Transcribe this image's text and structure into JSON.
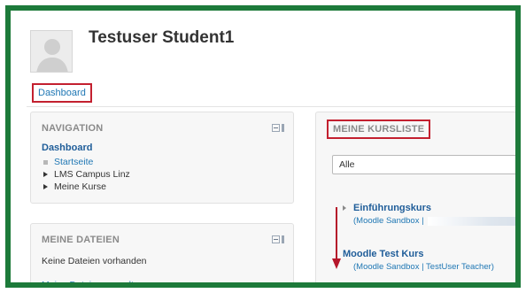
{
  "header": {
    "user_name": "Testuser Student1"
  },
  "breadcrumb": {
    "dashboard": "Dashboard"
  },
  "navigation": {
    "title": "NAVIGATION",
    "root": "Dashboard",
    "items": [
      {
        "label": "Startseite",
        "type": "link"
      },
      {
        "label": "LMS Campus Linz",
        "type": "expandable"
      },
      {
        "label": "Meine Kurse",
        "type": "expandable"
      }
    ]
  },
  "files": {
    "title": "MEINE DATEIEN",
    "empty_text": "Keine Dateien vorhanden",
    "manage_link": "Meine Dateien verwalten..."
  },
  "courses": {
    "title": "MEINE KURSLISTE",
    "filter_value": "Alle",
    "items": [
      {
        "name": "Einführungskurs",
        "meta": "(Moodle Sandbox  |"
      },
      {
        "name": "Moodle Test Kurs",
        "meta": "(Moodle Sandbox  |  TestUser Teacher)"
      }
    ]
  },
  "colors": {
    "frame": "#1d7a3a",
    "highlight_box": "#c3202f",
    "link": "#1f77b4",
    "arrow": "#b5162a"
  }
}
